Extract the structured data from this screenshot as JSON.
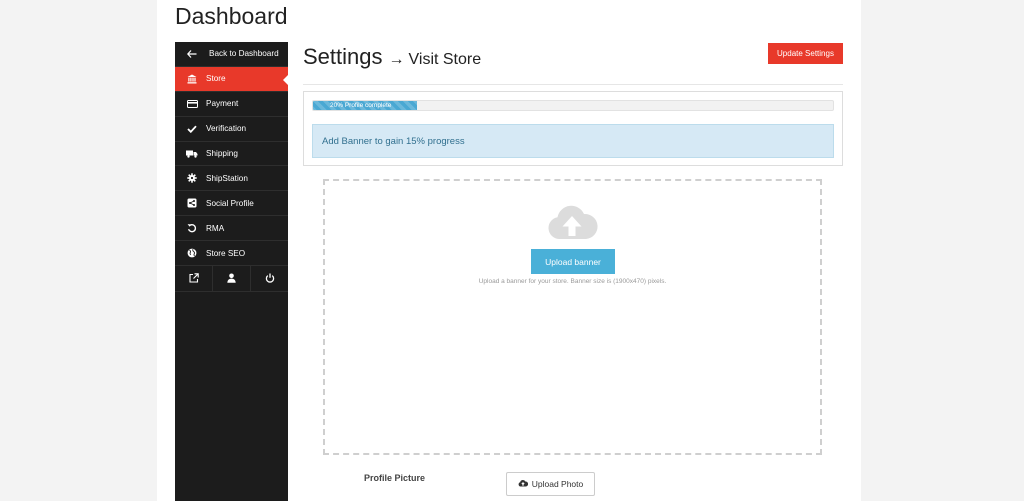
{
  "page": {
    "title": "Dashboard"
  },
  "sidebar": {
    "items": [
      {
        "label": "Back to Dashboard",
        "icon": "arrow-left-icon"
      },
      {
        "label": "Store",
        "icon": "bank-icon",
        "active": true
      },
      {
        "label": "Payment",
        "icon": "credit-card-icon"
      },
      {
        "label": "Verification",
        "icon": "check-icon"
      },
      {
        "label": "Shipping",
        "icon": "truck-icon"
      },
      {
        "label": "ShipStation",
        "icon": "gear-icon"
      },
      {
        "label": "Social Profile",
        "icon": "share-icon"
      },
      {
        "label": "RMA",
        "icon": "undo-icon"
      },
      {
        "label": "Store SEO",
        "icon": "globe-icon"
      }
    ],
    "bottom_icons": [
      "external-link-icon",
      "user-icon",
      "power-icon"
    ]
  },
  "settings": {
    "title": "Settings",
    "arrow": "→",
    "visit_store": "Visit Store",
    "update_button": "Update Settings"
  },
  "progress": {
    "percent": 20,
    "label": "20% Profile complete",
    "alert": "Add Banner to gain 15% progress"
  },
  "banner": {
    "upload_button": "Upload banner",
    "help_text": "Upload a banner for your store. Banner size is (1900x470) pixels."
  },
  "profile_picture": {
    "label": "Profile Picture",
    "upload_button": "Upload Photo"
  },
  "colors": {
    "accent": "#e8392a",
    "sidebar_bg": "#1c1c1c",
    "info": "#4ab0d8",
    "alert_bg": "#d6e9f5"
  }
}
